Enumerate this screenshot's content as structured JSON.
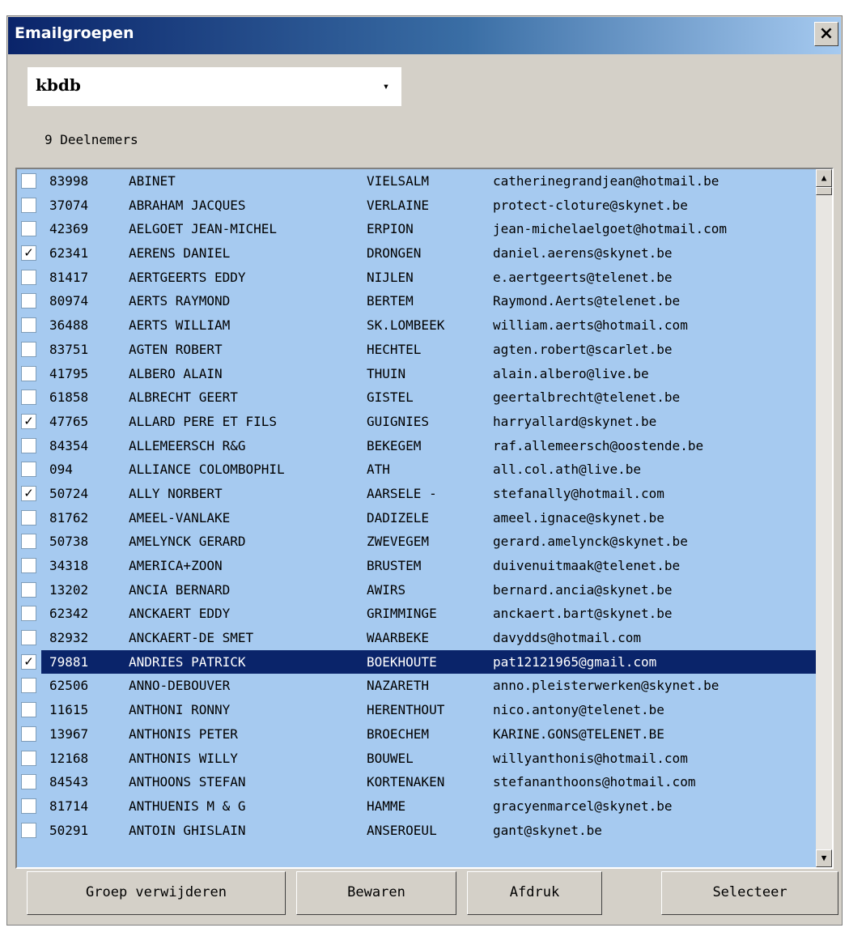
{
  "window": {
    "title": "Emailgroepen",
    "close_label": "×"
  },
  "group_select": {
    "value": "kbdb",
    "arrow": "▾"
  },
  "participants": "9 Deelnemers",
  "scroll": {
    "up": "▲",
    "down": "▼"
  },
  "rows": [
    {
      "checked": false,
      "nr": "83998",
      "name": "ABINET",
      "town": "VIELSALM",
      "email": "catherinegrandjean@hotmail.be"
    },
    {
      "checked": false,
      "nr": "37074",
      "name": "ABRAHAM JACQUES",
      "town": "VERLAINE",
      "email": "protect-cloture@skynet.be"
    },
    {
      "checked": false,
      "nr": "42369",
      "name": "AELGOET JEAN-MICHEL",
      "town": "ERPION",
      "email": "jean-michelaelgoet@hotmail.com"
    },
    {
      "checked": true,
      "nr": "62341",
      "name": "AERENS DANIEL",
      "town": "DRONGEN",
      "email": "daniel.aerens@skynet.be"
    },
    {
      "checked": false,
      "nr": "81417",
      "name": "AERTGEERTS EDDY",
      "town": "NIJLEN",
      "email": "e.aertgeerts@telenet.be"
    },
    {
      "checked": false,
      "nr": "80974",
      "name": "AERTS RAYMOND",
      "town": "BERTEM",
      "email": "Raymond.Aerts@telenet.be"
    },
    {
      "checked": false,
      "nr": "36488",
      "name": "AERTS WILLIAM",
      "town": "SK.LOMBEEK",
      "email": "william.aerts@hotmail.com"
    },
    {
      "checked": false,
      "nr": "83751",
      "name": "AGTEN ROBERT",
      "town": "HECHTEL",
      "email": "agten.robert@scarlet.be"
    },
    {
      "checked": false,
      "nr": "41795",
      "name": "ALBERO ALAIN",
      "town": "THUIN",
      "email": "alain.albero@live.be"
    },
    {
      "checked": false,
      "nr": "61858",
      "name": "ALBRECHT GEERT",
      "town": "GISTEL",
      "email": "geertalbrecht@telenet.be"
    },
    {
      "checked": true,
      "nr": "47765",
      "name": "ALLARD PERE ET FILS",
      "town": "GUIGNIES",
      "email": "harryallard@skynet.be"
    },
    {
      "checked": false,
      "nr": "84354",
      "name": "ALLEMEERSCH R&G",
      "town": "BEKEGEM",
      "email": "raf.allemeersch@oostende.be"
    },
    {
      "checked": false,
      "nr": "094",
      "name": "ALLIANCE COLOMBOPHIL",
      "town": "ATH",
      "email": "all.col.ath@live.be"
    },
    {
      "checked": true,
      "nr": "50724",
      "name": "ALLY NORBERT",
      "town": "AARSELE -",
      "email": "stefanally@hotmail.com"
    },
    {
      "checked": false,
      "nr": "81762",
      "name": "AMEEL-VANLAKE",
      "town": "DADIZELE",
      "email": "ameel.ignace@skynet.be"
    },
    {
      "checked": false,
      "nr": "50738",
      "name": "AMELYNCK GERARD",
      "town": "ZWEVEGEM",
      "email": "gerard.amelynck@skynet.be"
    },
    {
      "checked": false,
      "nr": "34318",
      "name": "AMERICA+ZOON",
      "town": "BRUSTEM",
      "email": "duivenuitmaak@telenet.be"
    },
    {
      "checked": false,
      "nr": "13202",
      "name": "ANCIA BERNARD",
      "town": "AWIRS",
      "email": "bernard.ancia@skynet.be"
    },
    {
      "checked": false,
      "nr": "62342",
      "name": "ANCKAERT EDDY",
      "town": "GRIMMINGE",
      "email": "anckaert.bart@skynet.be"
    },
    {
      "checked": false,
      "nr": "82932",
      "name": "ANCKAERT-DE SMET",
      "town": "WAARBEKE",
      "email": "davydds@hotmail.com"
    },
    {
      "checked": true,
      "nr": "79881",
      "name": "ANDRIES PATRICK",
      "town": "BOEKHOUTE",
      "email": "pat12121965@gmail.com",
      "selected": true
    },
    {
      "checked": false,
      "nr": "62506",
      "name": "ANNO-DEBOUVER",
      "town": "NAZARETH",
      "email": "anno.pleisterwerken@skynet.be"
    },
    {
      "checked": false,
      "nr": "11615",
      "name": "ANTHONI RONNY",
      "town": "HERENTHOUT",
      "email": "nico.antony@telenet.be"
    },
    {
      "checked": false,
      "nr": "13967",
      "name": "ANTHONIS PETER",
      "town": "BROECHEM",
      "email": "KARINE.GONS@TELENET.BE"
    },
    {
      "checked": false,
      "nr": "12168",
      "name": "ANTHONIS WILLY",
      "town": "BOUWEL",
      "email": "willyanthonis@hotmail.com"
    },
    {
      "checked": false,
      "nr": "84543",
      "name": "ANTHOONS STEFAN",
      "town": "KORTENAKEN",
      "email": "stefananthoons@hotmail.com"
    },
    {
      "checked": false,
      "nr": "81714",
      "name": "ANTHUENIS M & G",
      "town": "HAMME",
      "email": "gracyenmarcel@skynet.be"
    },
    {
      "checked": false,
      "nr": "50291",
      "name": "ANTOIN GHISLAIN",
      "town": "ANSEROEUL",
      "email": "gant@skynet.be"
    }
  ],
  "buttons": {
    "delete_group": "Groep verwijderen",
    "save": "Bewaren",
    "print": "Afdruk",
    "select": "Selecteer"
  }
}
